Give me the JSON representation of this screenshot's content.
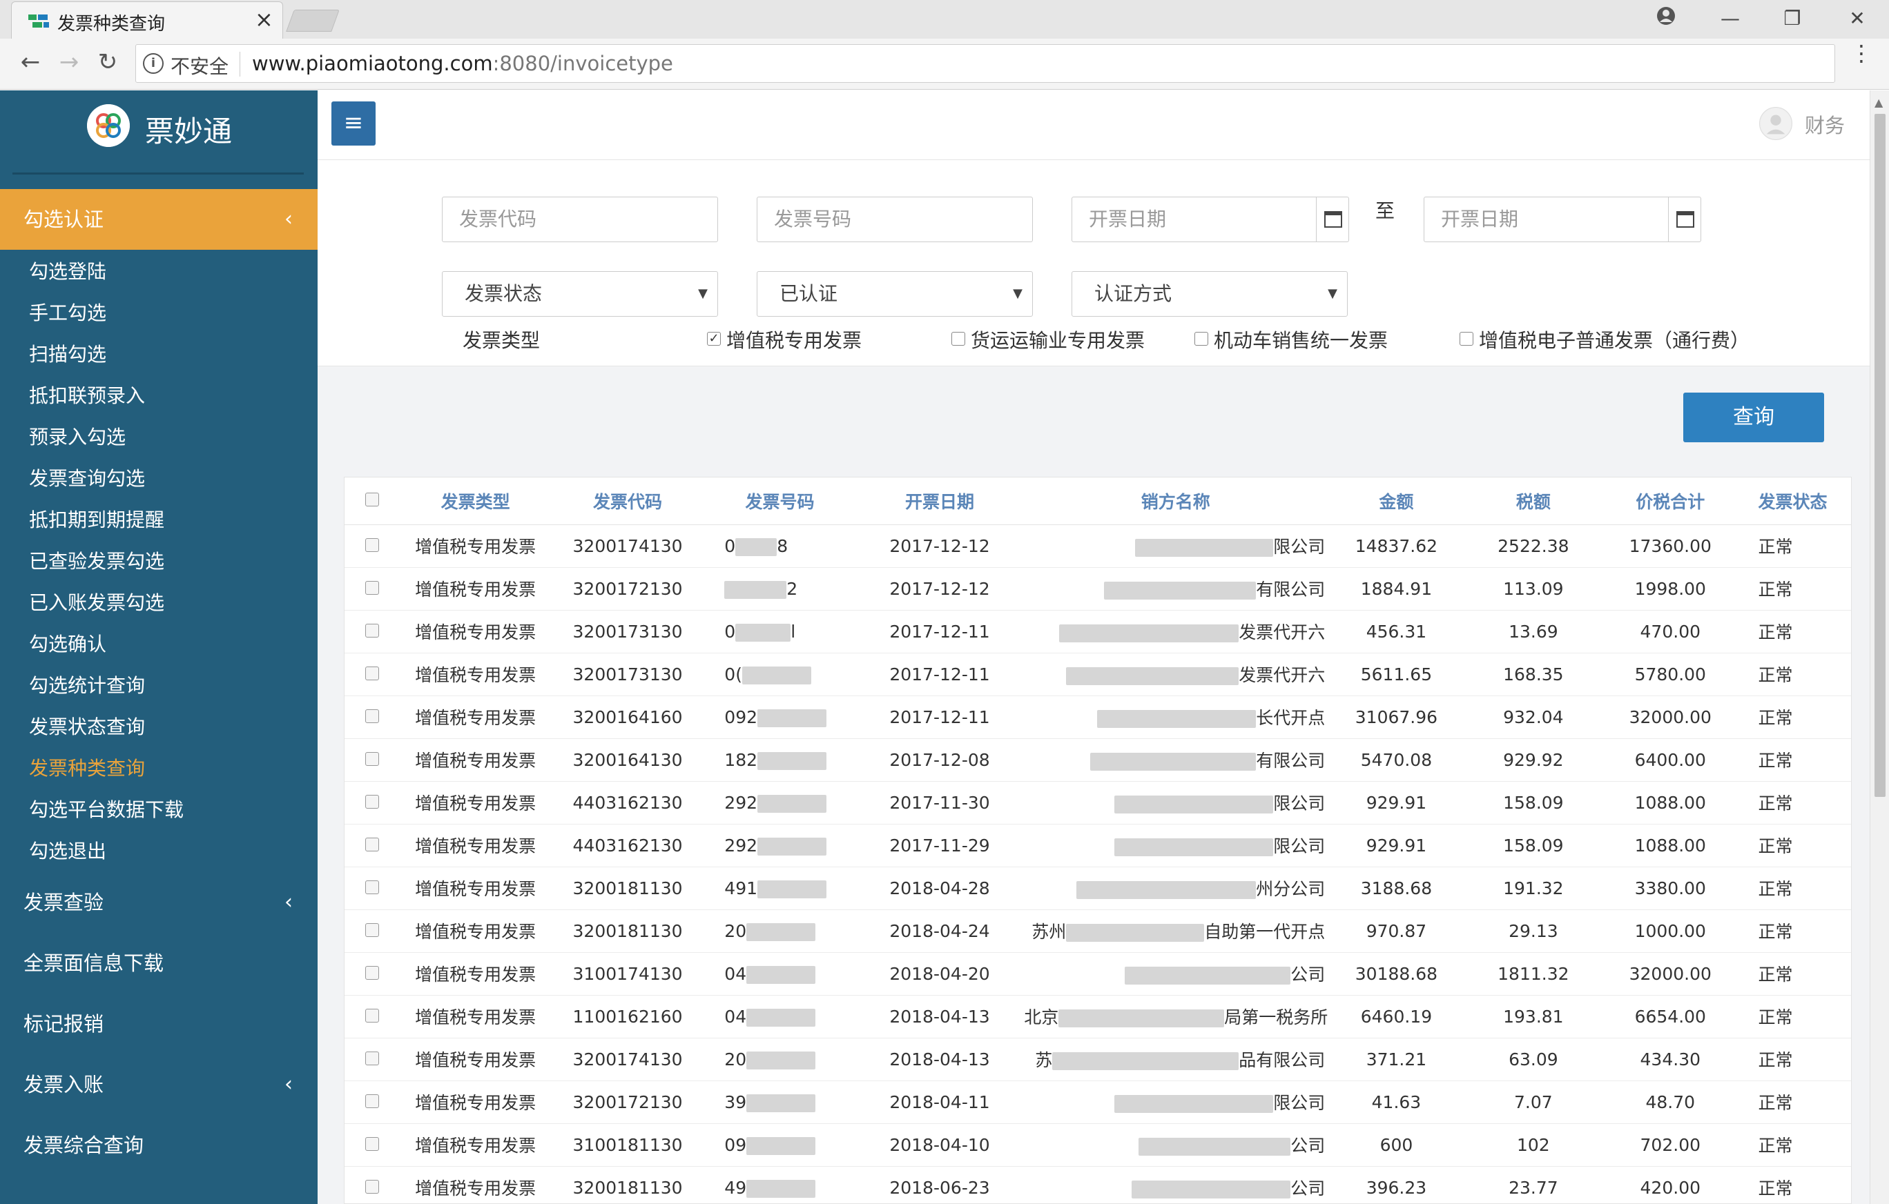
{
  "browser": {
    "tab_title": "发票种类查询",
    "tab_close": "×",
    "back": "←",
    "forward": "→",
    "reload": "↻",
    "insecure_label": "不安全",
    "url_host": "www.piaomiaotong.com",
    "url_rest": ":8080/invoicetype",
    "star": "☆",
    "menu": "⋮",
    "win_min": "—",
    "win_max": "❐",
    "win_close": "✕"
  },
  "app": {
    "brand": "票妙通",
    "hamburger": "≡",
    "user_name": "财务"
  },
  "sidebar": {
    "sections": [
      {
        "label": "勾选认证",
        "chevron": "‹"
      },
      {
        "label": "发票查验",
        "chevron": "‹"
      },
      {
        "label": "全票面信息下载",
        "chevron": ""
      },
      {
        "label": "标记报销",
        "chevron": ""
      },
      {
        "label": "发票入账",
        "chevron": "‹"
      },
      {
        "label": "发票综合查询",
        "chevron": ""
      }
    ],
    "sub_items": [
      "勾选登陆",
      "手工勾选",
      "扫描勾选",
      "抵扣联预录入",
      "预录入勾选",
      "发票查询勾选",
      "抵扣期到期提醒",
      "已查验发票勾选",
      "已入账发票勾选",
      "勾选确认",
      "勾选统计查询",
      "发票状态查询",
      "发票种类查询",
      "勾选平台数据下载",
      "勾选退出"
    ]
  },
  "filters": {
    "code_placeholder": "发票代码",
    "number_placeholder": "发票号码",
    "date_from_placeholder": "开票日期",
    "to_label": "至",
    "date_to_placeholder": "开票日期",
    "status_select": "发票状态",
    "auth_select": "已认证",
    "auth_method_select": "认证方式",
    "select_arrow": "▼",
    "type_label": "发票类型",
    "types": [
      {
        "label": "增值税专用发票",
        "checked": true
      },
      {
        "label": "货运运输业专用发票",
        "checked": false
      },
      {
        "label": "机动车销售统一发票",
        "checked": false
      },
      {
        "label": "增值税电子普通发票（通行费）",
        "checked": false
      }
    ],
    "query_button": "查询"
  },
  "table": {
    "headers": [
      "发票类型",
      "发票代码",
      "发票号码",
      "开票日期",
      "销方名称",
      "金额",
      "税额",
      "价税合计",
      "发票状态"
    ],
    "rows": [
      {
        "type": "增值税专用发票",
        "code": "3200174130",
        "num_pre": "0",
        "num_suf": "8",
        "date": "2017-12-12",
        "seller_pre": "",
        "seller_suf": "限公司",
        "amount": "14837.62",
        "tax": "2522.38",
        "total": "17360.00",
        "status": "正常"
      },
      {
        "type": "增值税专用发票",
        "code": "3200172130",
        "num_pre": "",
        "num_suf": "2",
        "date": "2017-12-12",
        "seller_pre": "",
        "seller_suf": "有限公司",
        "amount": "1884.91",
        "tax": "113.09",
        "total": "1998.00",
        "status": "正常"
      },
      {
        "type": "增值税专用发票",
        "code": "3200173130",
        "num_pre": "0",
        "num_suf": "l",
        "date": "2017-12-11",
        "seller_pre": "",
        "seller_suf": "发票代开六",
        "amount": "456.31",
        "tax": "13.69",
        "total": "470.00",
        "status": "正常"
      },
      {
        "type": "增值税专用发票",
        "code": "3200173130",
        "num_pre": "0(",
        "num_suf": "",
        "date": "2017-12-11",
        "seller_pre": "",
        "seller_suf": "发票代开六",
        "amount": "5611.65",
        "tax": "168.35",
        "total": "5780.00",
        "status": "正常"
      },
      {
        "type": "增值税专用发票",
        "code": "3200164160",
        "num_pre": "092",
        "num_suf": "",
        "date": "2017-12-11",
        "seller_pre": "",
        "seller_suf": "长代开点",
        "amount": "31067.96",
        "tax": "932.04",
        "total": "32000.00",
        "status": "正常"
      },
      {
        "type": "增值税专用发票",
        "code": "3200164130",
        "num_pre": "182",
        "num_suf": "",
        "date": "2017-12-08",
        "seller_pre": "",
        "seller_suf": "有限公司",
        "amount": "5470.08",
        "tax": "929.92",
        "total": "6400.00",
        "status": "正常"
      },
      {
        "type": "增值税专用发票",
        "code": "4403162130",
        "num_pre": "292",
        "num_suf": "",
        "date": "2017-11-30",
        "seller_pre": "",
        "seller_suf": "限公司",
        "amount": "929.91",
        "tax": "158.09",
        "total": "1088.00",
        "status": "正常"
      },
      {
        "type": "增值税专用发票",
        "code": "4403162130",
        "num_pre": "292",
        "num_suf": "",
        "date": "2017-11-29",
        "seller_pre": "",
        "seller_suf": "限公司",
        "amount": "929.91",
        "tax": "158.09",
        "total": "1088.00",
        "status": "正常"
      },
      {
        "type": "增值税专用发票",
        "code": "3200181130",
        "num_pre": "491",
        "num_suf": "",
        "date": "2018-04-28",
        "seller_pre": "",
        "seller_suf": "州分公司",
        "amount": "3188.68",
        "tax": "191.32",
        "total": "3380.00",
        "status": "正常"
      },
      {
        "type": "增值税专用发票",
        "code": "3200181130",
        "num_pre": "20",
        "num_suf": "",
        "date": "2018-04-24",
        "seller_pre": "苏州",
        "seller_suf": "自助第一代开点",
        "amount": "970.87",
        "tax": "29.13",
        "total": "1000.00",
        "status": "正常"
      },
      {
        "type": "增值税专用发票",
        "code": "3100174130",
        "num_pre": "04",
        "num_suf": "",
        "date": "2018-04-20",
        "seller_pre": "",
        "seller_suf": "公司",
        "amount": "30188.68",
        "tax": "1811.32",
        "total": "32000.00",
        "status": "正常"
      },
      {
        "type": "增值税专用发票",
        "code": "1100162160",
        "num_pre": "04",
        "num_suf": "",
        "date": "2018-04-13",
        "seller_pre": "北京",
        "seller_suf": "局第一税务所",
        "amount": "6460.19",
        "tax": "193.81",
        "total": "6654.00",
        "status": "正常"
      },
      {
        "type": "增值税专用发票",
        "code": "3200174130",
        "num_pre": "20",
        "num_suf": "",
        "date": "2018-04-13",
        "seller_pre": "苏",
        "seller_suf": "品有限公司",
        "amount": "371.21",
        "tax": "63.09",
        "total": "434.30",
        "status": "正常"
      },
      {
        "type": "增值税专用发票",
        "code": "3200172130",
        "num_pre": "39",
        "num_suf": "",
        "date": "2018-04-11",
        "seller_pre": "",
        "seller_suf": "限公司",
        "amount": "41.63",
        "tax": "7.07",
        "total": "48.70",
        "status": "正常"
      },
      {
        "type": "增值税专用发票",
        "code": "3100181130",
        "num_pre": "09",
        "num_suf": "",
        "date": "2018-04-10",
        "seller_pre": "",
        "seller_suf": "公司",
        "amount": "600",
        "tax": "102",
        "total": "702.00",
        "status": "正常"
      },
      {
        "type": "增值税专用发票",
        "code": "3200181130",
        "num_pre": "49",
        "num_suf": "",
        "date": "2018-06-23",
        "seller_pre": "",
        "seller_suf": "公司",
        "amount": "396.23",
        "tax": "23.77",
        "total": "420.00",
        "status": "正常"
      }
    ]
  },
  "colors": {
    "sidebar_bg": "#235e7c",
    "active_menu": "#eaa33b",
    "primary_button": "#2e81c0",
    "table_header_text": "#5b86b8"
  }
}
